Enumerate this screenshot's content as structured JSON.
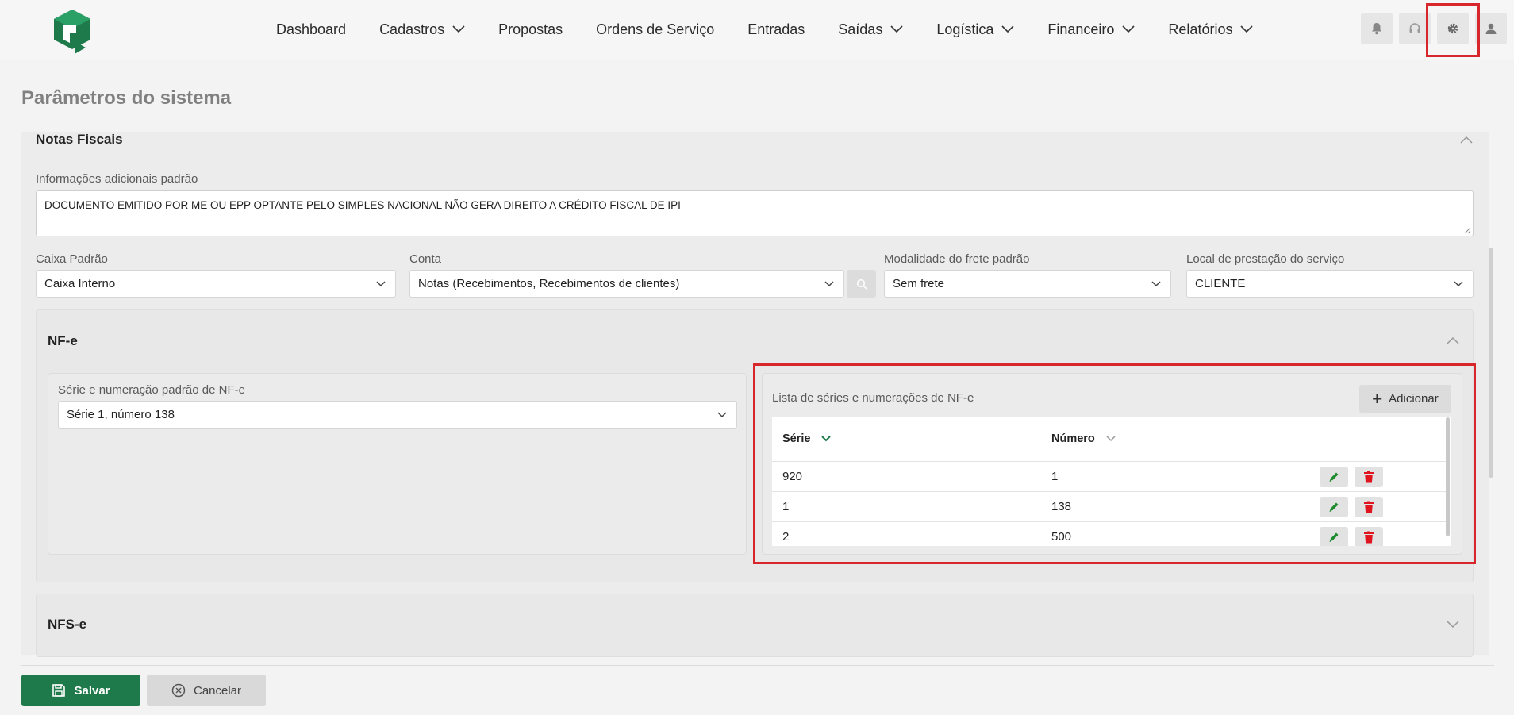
{
  "nav": {
    "items": [
      {
        "label": "Dashboard",
        "dropdown": false
      },
      {
        "label": "Cadastros",
        "dropdown": true
      },
      {
        "label": "Propostas",
        "dropdown": false
      },
      {
        "label": "Ordens de Serviço",
        "dropdown": false
      },
      {
        "label": "Entradas",
        "dropdown": false
      },
      {
        "label": "Saídas",
        "dropdown": true
      },
      {
        "label": "Logística",
        "dropdown": true
      },
      {
        "label": "Financeiro",
        "dropdown": true
      },
      {
        "label": "Relatórios",
        "dropdown": true
      }
    ],
    "icons": [
      "bell-icon",
      "headset-icon",
      "gear-icon",
      "user-icon"
    ]
  },
  "page": {
    "title": "Parâmetros do sistema"
  },
  "notas": {
    "section_title": "Notas Fiscais",
    "info_label": "Informações adicionais padrão",
    "info_value": "DOCUMENTO EMITIDO POR ME OU EPP OPTANTE PELO SIMPLES NACIONAL NÃO GERA DIREITO A CRÉDITO FISCAL DE IPI",
    "caixa_label": "Caixa Padrão",
    "caixa_value": "Caixa Interno",
    "conta_label": "Conta",
    "conta_value": "Notas (Recebimentos, Recebimentos de clientes)",
    "frete_label": "Modalidade do frete padrão",
    "frete_value": "Sem frete",
    "local_label": "Local de prestação do serviço",
    "local_value": "CLIENTE"
  },
  "nfe": {
    "section_title": "NF-e",
    "serie_label": "Série e numeração padrão de NF-e",
    "serie_value": "Série 1, número 138",
    "list_title": "Lista de séries e numerações de NF-e",
    "add_label": "Adicionar",
    "columns": {
      "serie": "Série",
      "numero": "Número"
    },
    "rows": [
      {
        "serie": "920",
        "numero": "1"
      },
      {
        "serie": "1",
        "numero": "138"
      },
      {
        "serie": "2",
        "numero": "500"
      }
    ]
  },
  "nfse": {
    "section_title": "NFS-e"
  },
  "footer": {
    "save_label": "Salvar",
    "cancel_label": "Cancelar"
  },
  "colors": {
    "brand": "#1e7a4a",
    "highlight": "#d7262c",
    "delete": "#e0141e",
    "edit": "#1e8a2e"
  }
}
